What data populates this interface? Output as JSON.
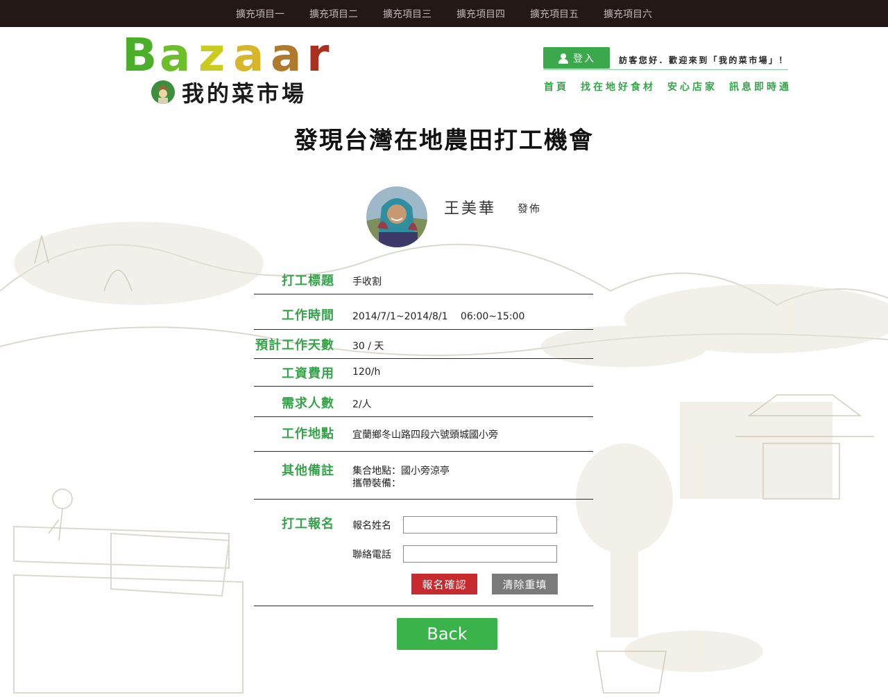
{
  "topnav": {
    "items": [
      "擴充項目一",
      "擴充項目二",
      "擴充項目三",
      "擴充項目四",
      "擴充項目五",
      "擴充項目六"
    ]
  },
  "logo": {
    "brand": "Bazaar",
    "subtitle": "我的菜市場"
  },
  "header": {
    "login_label": "登入",
    "welcome": "訪客您好．歡迎來到「我的菜市場」！",
    "nav": [
      "首頁",
      "找在地好食材",
      "安心店家",
      "訊息即時通"
    ]
  },
  "page": {
    "title": "發現台灣在地農田打工機會"
  },
  "publisher": {
    "name": "王美華",
    "action": "發佈"
  },
  "job": {
    "title_label": "打工標題",
    "title_value": "手收割",
    "time_label": "工作時間",
    "time_value": "2014/7/1~2014/8/1　 06:00~15:00",
    "days_label": "預計工作天數",
    "days_value": "30 / 天",
    "wage_label": "工資費用",
    "wage_value": "120/h",
    "people_label": "需求人數",
    "people_value": "2/人",
    "location_label": "工作地點",
    "location_value": "宜蘭鄉冬山路四段六號頭城國小旁",
    "notes_label": "其他備註",
    "notes_line1": "集合地點：國小旁涼亭",
    "notes_line2": "攜帶裝備："
  },
  "signup": {
    "label": "打工報名",
    "name_label": "報名姓名",
    "name_value": "",
    "phone_label": "聯絡電話",
    "phone_value": "",
    "submit_label": "報名確認",
    "reset_label": "清除重填"
  },
  "back_label": "Back",
  "colors": {
    "green": "#36a34a",
    "topbar": "#231815",
    "submit": "#c72a2e",
    "reset": "#7a7a7a"
  }
}
